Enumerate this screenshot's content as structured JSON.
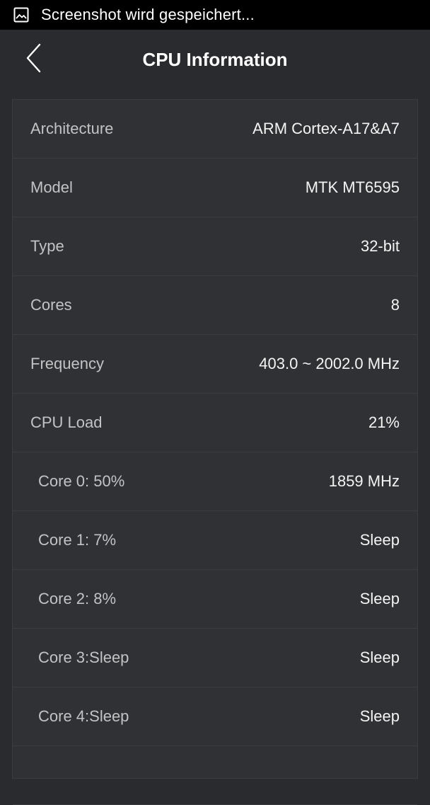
{
  "status_bar": {
    "icon": "image-icon",
    "text": "Screenshot wird gespeichert..."
  },
  "header": {
    "back_icon": "chevron-left-icon",
    "title": "CPU Information"
  },
  "rows": [
    {
      "label": "Architecture",
      "value": "ARM Cortex-A17&A7"
    },
    {
      "label": "Model",
      "value": "MTK MT6595"
    },
    {
      "label": "Type",
      "value": "32-bit"
    },
    {
      "label": "Cores",
      "value": "8"
    },
    {
      "label": "Frequency",
      "value": "403.0 ~ 2002.0 MHz"
    },
    {
      "label": "CPU Load",
      "value": "21%"
    },
    {
      "label": "Core 0: 50%",
      "value": "1859 MHz"
    },
    {
      "label": "Core 1: 7%",
      "value": "Sleep"
    },
    {
      "label": "Core 2: 8%",
      "value": "Sleep"
    },
    {
      "label": "Core 3:Sleep",
      "value": "Sleep"
    },
    {
      "label": "Core 4:Sleep",
      "value": "Sleep"
    }
  ]
}
